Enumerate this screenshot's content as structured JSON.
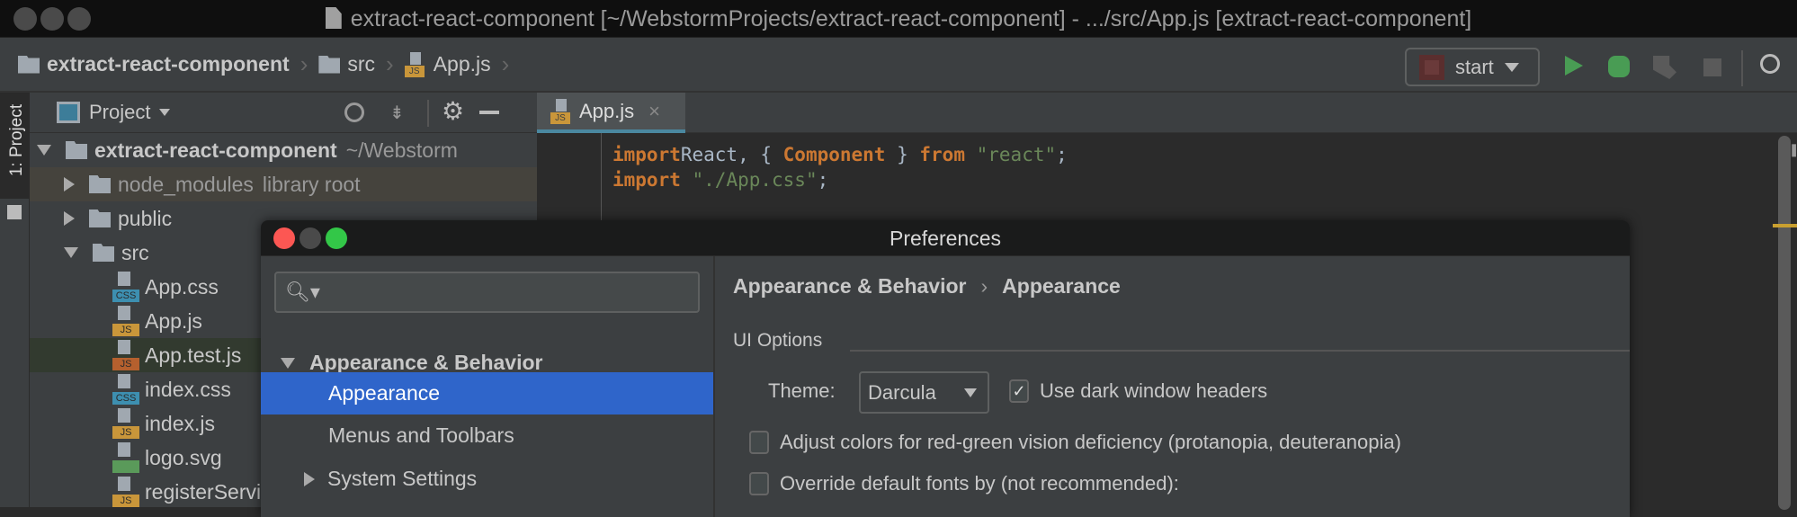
{
  "window": {
    "title": "extract-react-component [~/WebstormProjects/extract-react-component] - .../src/App.js [extract-react-component]"
  },
  "navbar": {
    "breadcrumb": [
      "extract-react-component",
      "src",
      "App.js"
    ],
    "run_config": "start",
    "icons": [
      "run-icon",
      "debug-icon",
      "coverage-icon",
      "stop-icon",
      "search-icon"
    ]
  },
  "tool_window": {
    "stripe_label": "1: Project",
    "header": "Project"
  },
  "tree": [
    {
      "name": "extract-react-component",
      "hint": "~/Webstorm",
      "type": "folder",
      "open": true,
      "depth": 0
    },
    {
      "name": "node_modules",
      "hint": "library root",
      "type": "folder",
      "open": false,
      "depth": 1
    },
    {
      "name": "public",
      "type": "folder",
      "open": false,
      "depth": 1
    },
    {
      "name": "src",
      "type": "folder",
      "open": true,
      "depth": 1
    },
    {
      "name": "App.css",
      "type": "css",
      "depth": 2
    },
    {
      "name": "App.js",
      "type": "js",
      "depth": 2
    },
    {
      "name": "App.test.js",
      "type": "test",
      "depth": 2
    },
    {
      "name": "index.css",
      "type": "css",
      "depth": 2
    },
    {
      "name": "index.js",
      "type": "js",
      "depth": 2
    },
    {
      "name": "logo.svg",
      "type": "svg",
      "depth": 2
    },
    {
      "name": "registerServiceWorker.js",
      "type": "js",
      "depth": 2
    }
  ],
  "editor": {
    "tab": "App.js",
    "lines": [
      [
        [
          "kw",
          "import"
        ],
        [
          "",
          "React, { "
        ],
        [
          "kw",
          "Component"
        ],
        [
          "",
          ""
        ],
        [
          "",
          ""
        ],
        [
          "",
          " } "
        ],
        [
          "kw",
          "from"
        ],
        [
          "",
          " "
        ],
        [
          "str",
          "\"react\""
        ],
        [
          "",
          ";"
        ]
      ],
      [
        [
          "kw",
          "import"
        ],
        [
          "",
          " "
        ],
        [
          "str",
          "\"./App.css\""
        ],
        [
          "",
          ";"
        ]
      ]
    ]
  },
  "preferences": {
    "title": "Preferences",
    "search_placeholder": "",
    "nav": [
      {
        "label": "Appearance & Behavior",
        "expanded": true
      },
      {
        "label": "Appearance",
        "selected": true
      },
      {
        "label": "Menus and Toolbars"
      },
      {
        "label": "System Settings",
        "expandable": true
      }
    ],
    "breadcrumb": [
      "Appearance & Behavior",
      "Appearance"
    ],
    "section": "UI Options",
    "theme_label": "Theme:",
    "theme_value": "Darcula",
    "dark_headers": {
      "label": "Use dark window headers",
      "checked": true
    },
    "options": [
      {
        "label": "Adjust colors for red-green vision deficiency (protanopia, deuteranopia)",
        "checked": false
      },
      {
        "label": "Override default fonts by (not recommended):",
        "checked": false
      }
    ]
  },
  "colors": {
    "selection": "#2f65ca",
    "keyword": "#cc7832",
    "string": "#6a8759",
    "run": "#499c54"
  }
}
